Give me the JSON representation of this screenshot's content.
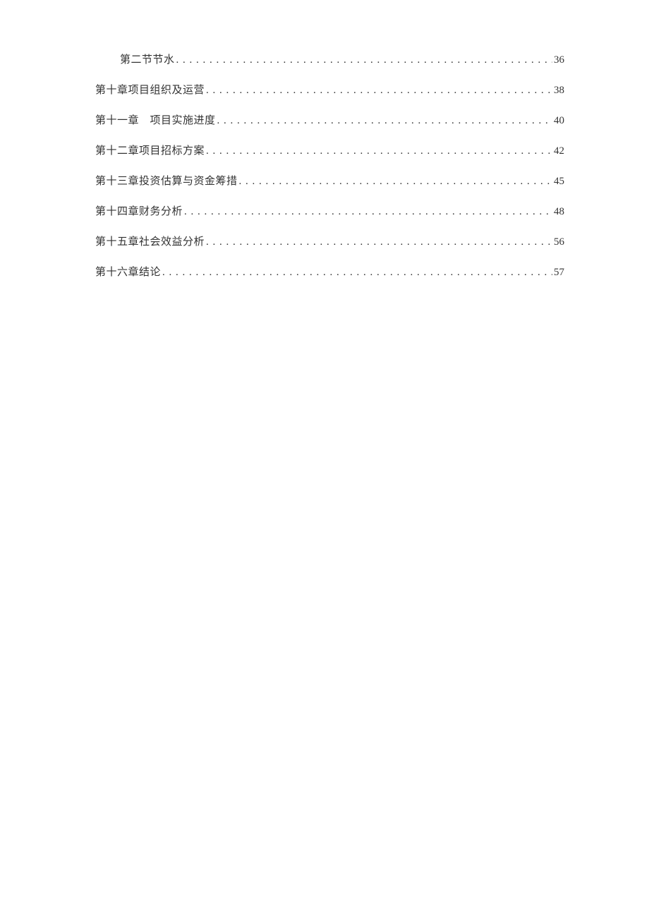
{
  "toc": {
    "entries": [
      {
        "title": "第二节节水",
        "page": "36",
        "indent": true
      },
      {
        "title": "第十章项目组织及运营",
        "page": "38",
        "indent": false
      },
      {
        "title": "第十一章　项目实施进度",
        "page": "40",
        "indent": false
      },
      {
        "title": "第十二章项目招标方案",
        "page": "42",
        "indent": false
      },
      {
        "title": "第十三章投资估算与资金筹措",
        "page": "45",
        "indent": false
      },
      {
        "title": "第十四章财务分析",
        "page": "48",
        "indent": false
      },
      {
        "title": "第十五章社会效益分析",
        "page": "56",
        "indent": false
      },
      {
        "title": "第十六章结论",
        "page": "57",
        "indent": false
      }
    ]
  }
}
